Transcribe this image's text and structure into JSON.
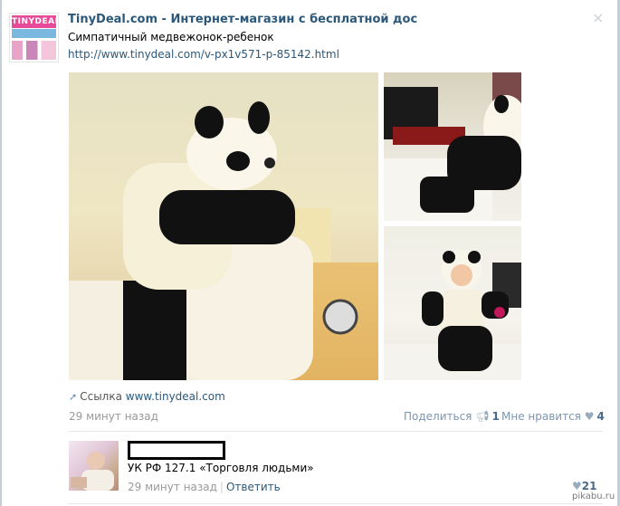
{
  "post": {
    "title": "TinyDeal.com - Интернет-магазин с бесплатной дос",
    "logo_text": "TINYDEAL",
    "description": "Симпатичный медвежонок-ребенок",
    "url": "http://www.tinydeal.com/v-px1v571-p-85142.html",
    "link_label": "Ссылка",
    "link_domain": "www.tinydeal.com",
    "time": "29 минут назад",
    "share_label": "Поделиться",
    "share_count": "1",
    "like_label": "Мне нравится",
    "like_count": "4",
    "close_glyph": "×"
  },
  "comment": {
    "text": "УК РФ 127.1 «Торговля людьми»",
    "time": "29 минут назад",
    "separator": "|",
    "reply_label": "Ответить",
    "like_count": "21"
  },
  "watermark": "pikabu.ru",
  "icons": {
    "share_icon": "megaphone-icon",
    "like_icon": "heart-icon",
    "link_icon": "link-arrow-icon"
  },
  "colors": {
    "link": "#2b587a",
    "muted": "#999999",
    "action": "#7d95ae"
  }
}
